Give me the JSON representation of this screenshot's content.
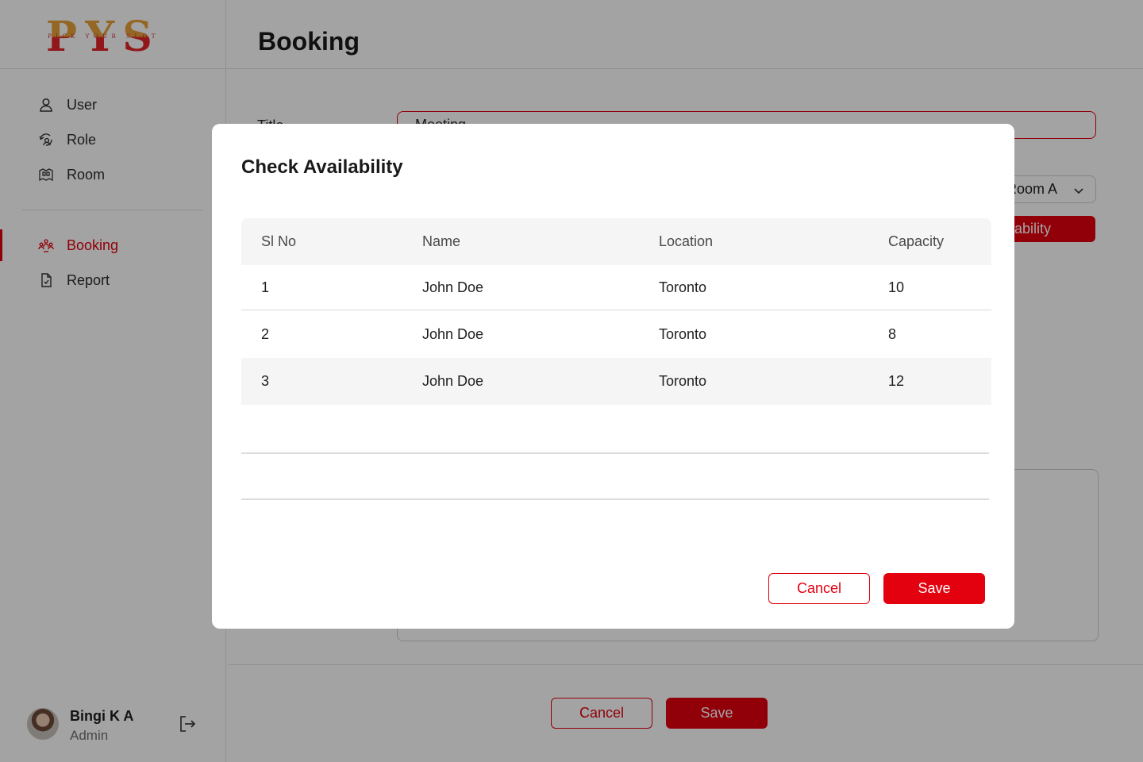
{
  "logo": {
    "letters": [
      "P",
      "Y",
      "S"
    ],
    "tagline": "PICK YOUR SLOT",
    "colors": {
      "top": "#e8a23a",
      "bottom": "#e3242b"
    }
  },
  "sidebar": {
    "items": [
      {
        "label": "User",
        "icon": "user-icon"
      },
      {
        "label": "Role",
        "icon": "role-icon"
      },
      {
        "label": "Room",
        "icon": "room-icon"
      },
      {
        "label": "Booking",
        "icon": "booking-icon",
        "active": true
      },
      {
        "label": "Report",
        "icon": "report-icon"
      }
    ]
  },
  "user": {
    "name": "Bingi K A",
    "role": "Admin"
  },
  "header": {
    "title": "Booking"
  },
  "form": {
    "title_label": "Title",
    "title_value": "Meeting",
    "room_value": "Room A",
    "check_button": "Check Availability"
  },
  "page_actions": {
    "cancel": "Cancel",
    "save": "Save"
  },
  "modal": {
    "title": "Check Availability",
    "columns": [
      "Sl No",
      "Name",
      "Location",
      "Capacity"
    ],
    "rows": [
      [
        "1",
        "John Doe",
        "Toronto",
        "10"
      ],
      [
        "2",
        "John Doe",
        "Toronto",
        "8"
      ],
      [
        "3",
        "John Doe",
        "Toronto",
        "12"
      ]
    ],
    "cancel": "Cancel",
    "save": "Save"
  },
  "colors": {
    "accent": "#e3000f",
    "overlay": "rgba(0,0,0,0.36)"
  }
}
